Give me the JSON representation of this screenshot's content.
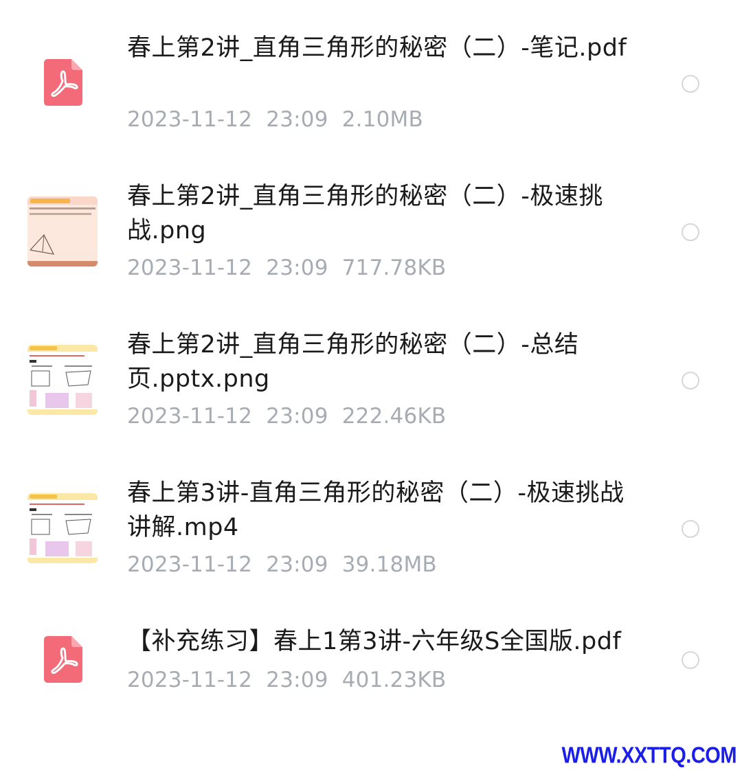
{
  "files": [
    {
      "name": "春上第2讲_直角三角形的秘密（二）-笔记.pdf",
      "date": "2023-11-12",
      "time": "23:09",
      "size": "2.10MB",
      "icon": "pdf-icon"
    },
    {
      "name": "春上第2讲_直角三角形的秘密（二）-极速挑战.png",
      "date": "2023-11-12",
      "time": "23:09",
      "size": "717.78KB",
      "icon": "image-thumbnail"
    },
    {
      "name": "春上第2讲_直角三角形的秘密（二）-总结页.pptx.png",
      "date": "2023-11-12",
      "time": "23:09",
      "size": "222.46KB",
      "icon": "image-thumbnail"
    },
    {
      "name": "春上第3讲-直角三角形的秘密（二）-极速挑战讲解.mp4",
      "date": "2023-11-12",
      "time": "23:09",
      "size": "39.18MB",
      "icon": "video-thumbnail"
    },
    {
      "name": "【补充练习】春上1第3讲-六年级S全国版.pdf",
      "date": "2023-11-12",
      "time": "23:09",
      "size": "401.23KB",
      "icon": "pdf-icon"
    }
  ],
  "watermark": "WWW.XXTTQ.COM",
  "colors": {
    "pdf_red": "#f36b78",
    "meta_gray": "#a7acb3",
    "watermark_blue": "#1a1ee8"
  }
}
